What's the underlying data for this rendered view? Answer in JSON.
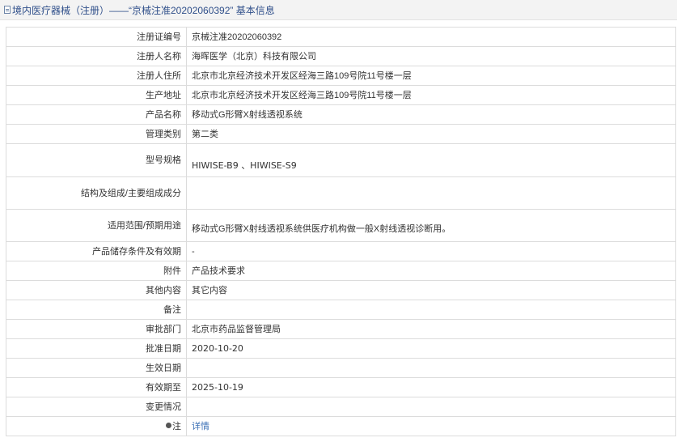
{
  "breadcrumb": "境内医疗器械（注册）——“京械注准20202060392” 基本信息",
  "rows": [
    {
      "label": "注册证编号",
      "value": "京械注准20202060392"
    },
    {
      "label": "注册人名称",
      "value": "海晖医学（北京）科技有限公司"
    },
    {
      "label": "注册人住所",
      "value": "北京市北京经济技术开发区经海三路109号院11号楼一层"
    },
    {
      "label": "生产地址",
      "value": "北京市北京经济技术开发区经海三路109号院11号楼一层"
    },
    {
      "label": "产品名称",
      "value": "移动式G形臂X射线透视系统"
    },
    {
      "label": "管理类别",
      "value": "第二类"
    },
    {
      "label": "型号规格",
      "value": "HIWISE-B9 、HIWISE-S9"
    },
    {
      "label": "结构及组成/主要组成成分",
      "value": ""
    },
    {
      "label": "适用范围/预期用途",
      "value": "移动式G形臂X射线透视系统供医疗机构做一般X射线透视诊断用。"
    },
    {
      "label": "产品储存条件及有效期",
      "value": "-"
    },
    {
      "label": "附件",
      "value": "产品技术要求"
    },
    {
      "label": "其他内容",
      "value": "其它内容"
    },
    {
      "label": "备注",
      "value": ""
    },
    {
      "label": "审批部门",
      "value": "北京市药品监督管理局"
    },
    {
      "label": "批准日期",
      "value": "2020-10-20"
    },
    {
      "label": "生效日期",
      "value": ""
    },
    {
      "label": "有效期至",
      "value": "2025-10-19"
    },
    {
      "label": "变更情况",
      "value": ""
    },
    {
      "label": "注",
      "value": "详情"
    }
  ],
  "icons": {
    "breadcrumb": "document-icon",
    "note": "bulb-icon"
  }
}
